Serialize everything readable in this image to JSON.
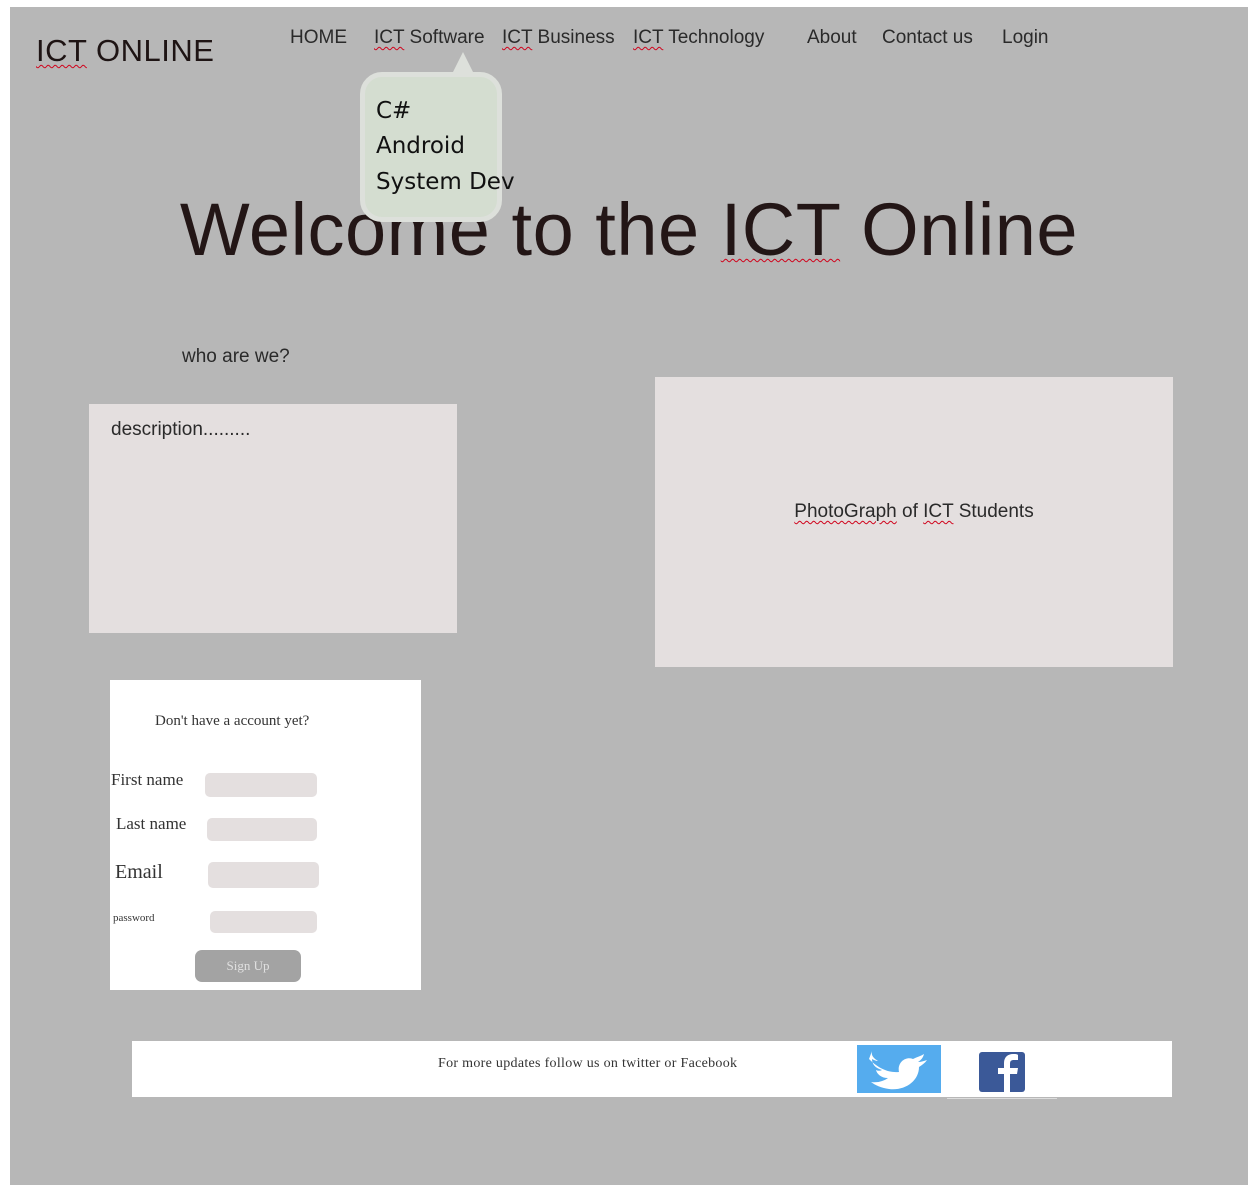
{
  "brand": {
    "logo_prefix": "ICT",
    "logo_suffix": " ONLINE"
  },
  "nav": {
    "home": "HOME",
    "ict": "ICT",
    "software": " Software",
    "business": " Business",
    "technology": " Technology",
    "about": "About",
    "contact": "Contact us",
    "login": "Login"
  },
  "software_submenu": [
    "C#",
    "Android",
    "System Dev"
  ],
  "hero": {
    "prefix": "Welcome to the ",
    "ict": "ICT",
    "suffix": " Online"
  },
  "about": {
    "heading": "who are we?",
    "description": "description........."
  },
  "photo": {
    "prefix": "PhotoGraph",
    "middle": " of ",
    "ict": "ICT",
    "suffix": " Students"
  },
  "signup": {
    "heading": "Don't have a account yet?",
    "first_name_label": "First name",
    "last_name_label": "Last name",
    "email_label": "Email",
    "password_label": "password",
    "button_label": "Sign Up"
  },
  "footer": {
    "text": "For more updates follow us on twitter or Facebook"
  },
  "icons": {
    "twitter": "twitter-icon",
    "facebook": "facebook-icon"
  },
  "colors": {
    "background": "#b7b7b7",
    "panel": "#e4dfdf",
    "twitter": "#55acee",
    "facebook": "#3b5998",
    "submenu": "#d4ddd0"
  }
}
